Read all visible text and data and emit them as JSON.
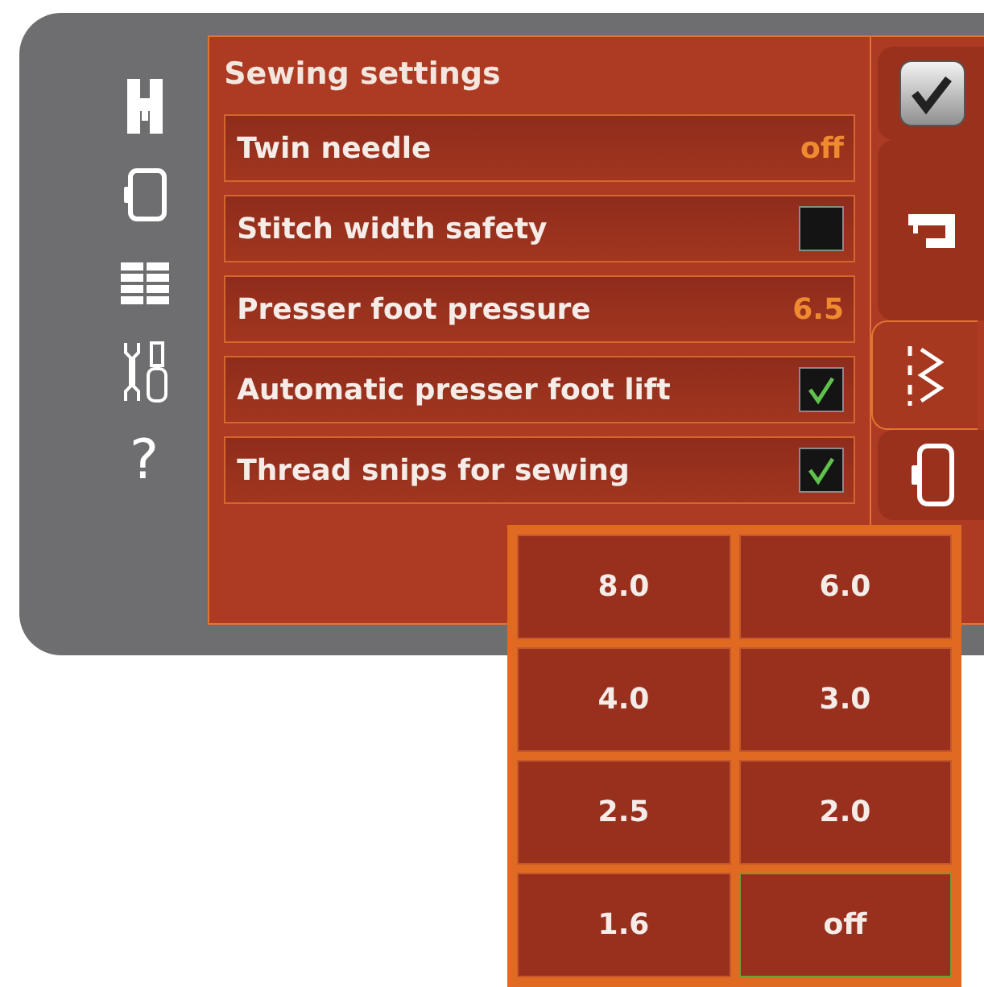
{
  "sidebar": {
    "items": [
      {
        "kind": "presser-foot"
      },
      {
        "kind": "hoop"
      },
      {
        "kind": "grid"
      },
      {
        "kind": "tools"
      },
      {
        "kind": "help",
        "label": "?"
      }
    ]
  },
  "settings": {
    "title": "Sewing settings",
    "rows": [
      {
        "label": "Twin needle",
        "kind": "value",
        "value": "off"
      },
      {
        "label": "Stitch width safety",
        "kind": "checkbox",
        "checked": false
      },
      {
        "label": "Presser foot pressure",
        "kind": "value",
        "value": "6.5"
      },
      {
        "label": "Automatic presser foot lift",
        "kind": "checkbox",
        "checked": true
      },
      {
        "label": "Thread snips for sewing",
        "kind": "checkbox",
        "checked": true
      }
    ]
  },
  "tabs": [
    {
      "kind": "confirm",
      "selected": false
    },
    {
      "kind": "machine",
      "selected": false
    },
    {
      "kind": "stitch",
      "selected": true
    },
    {
      "kind": "hoop",
      "selected": false
    }
  ],
  "popup": {
    "options": [
      {
        "label": "8.0",
        "selected": false
      },
      {
        "label": "6.0",
        "selected": false
      },
      {
        "label": "4.0",
        "selected": false
      },
      {
        "label": "3.0",
        "selected": false
      },
      {
        "label": "2.5",
        "selected": false
      },
      {
        "label": "2.0",
        "selected": false
      },
      {
        "label": "1.6",
        "selected": false
      },
      {
        "label": "off",
        "selected": true
      }
    ]
  }
}
